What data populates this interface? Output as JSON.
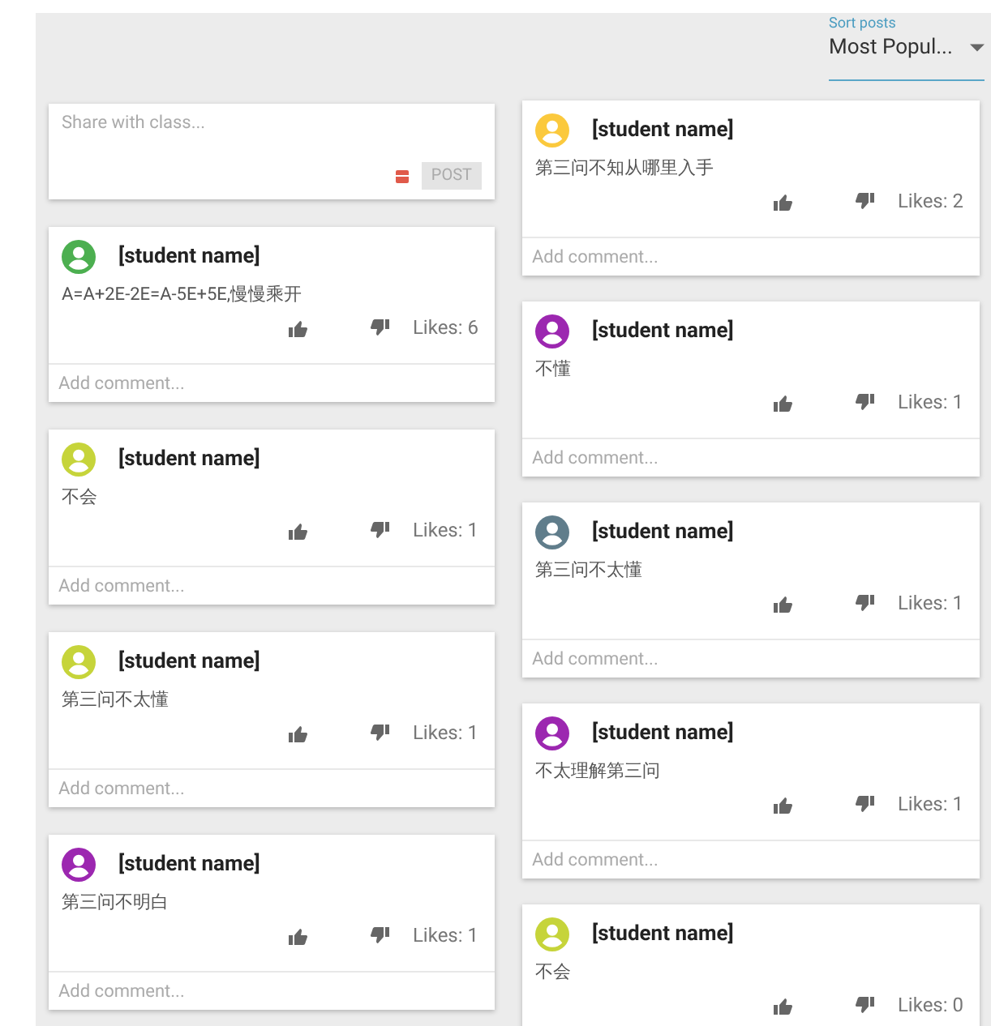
{
  "sort": {
    "label": "Sort posts",
    "value": "Most Popul..."
  },
  "composer": {
    "placeholder": "Share with class...",
    "button": "POST"
  },
  "left_posts": [
    {
      "author": "[student name]",
      "color": "#4caf50",
      "text": "A=A+2E-2E=A-5E+5E,慢慢乘开",
      "likes": "Likes: 6",
      "comment_placeholder": "Add comment..."
    },
    {
      "author": "[student name]",
      "color": "#c6d43a",
      "text": "不会",
      "likes": "Likes: 1",
      "comment_placeholder": "Add comment..."
    },
    {
      "author": "[student name]",
      "color": "#c6d43a",
      "text": "第三问不太懂",
      "likes": "Likes: 1",
      "comment_placeholder": "Add comment..."
    },
    {
      "author": "[student name]",
      "color": "#9c27b0",
      "text": "第三问不明白",
      "likes": "Likes: 1",
      "comment_placeholder": "Add comment..."
    }
  ],
  "right_posts": [
    {
      "author": "[student name]",
      "color": "#fbc93d",
      "text": "第三问不知从哪里入手",
      "likes": "Likes: 2",
      "comment_placeholder": "Add comment..."
    },
    {
      "author": "[student name]",
      "color": "#9c27b0",
      "text": "不懂",
      "likes": "Likes: 1",
      "comment_placeholder": "Add comment..."
    },
    {
      "author": "[student name]",
      "color": "#607d8b",
      "text": "第三问不太懂",
      "likes": "Likes: 1",
      "comment_placeholder": "Add comment..."
    },
    {
      "author": "[student name]",
      "color": "#9c27b0",
      "text": "不太理解第三问",
      "likes": "Likes: 1",
      "comment_placeholder": "Add comment..."
    },
    {
      "author": "[student name]",
      "color": "#c6d43a",
      "text": "不会",
      "likes": "Likes: 0"
    }
  ]
}
